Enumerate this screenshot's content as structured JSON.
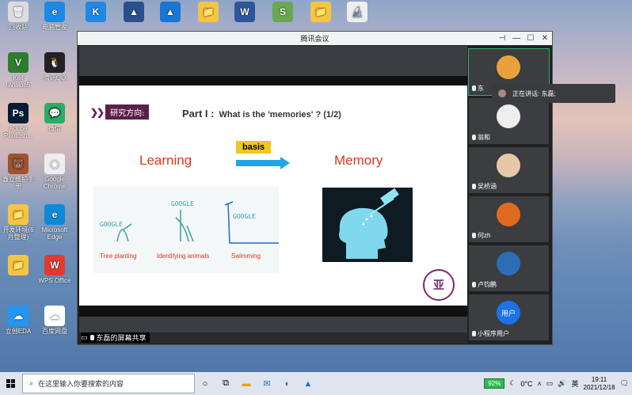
{
  "desktop": {
    "icons": [
      {
        "label": "回收站",
        "color": "#ddd",
        "glyph": "🗑"
      },
      {
        "label": "电脑管家",
        "color": "#1e88e5",
        "glyph": "e"
      },
      {
        "label": "",
        "color": "#1e88e5",
        "glyph": "K"
      },
      {
        "label": "",
        "color": "#2a4f8c",
        "glyph": "▲"
      },
      {
        "label": "",
        "color": "#1976d2",
        "glyph": "▲"
      },
      {
        "label": "",
        "color": "#f5c542",
        "glyph": "📁"
      },
      {
        "label": "",
        "color": "#2b579a",
        "glyph": "W"
      },
      {
        "label": "",
        "color": "#6aa84f",
        "glyph": "S"
      },
      {
        "label": "",
        "color": "#f5c542",
        "glyph": "📁"
      },
      {
        "label": "",
        "color": "#eee",
        "glyph": "🔬"
      },
      {
        "label": "Keil uVision5",
        "color": "#2d7d2d",
        "glyph": "V"
      },
      {
        "label": "腾讯QQ",
        "color": "#222",
        "glyph": "🐧"
      },
      {
        "label": "Adobe Photosh...",
        "color": "#001e36",
        "glyph": "Ps"
      },
      {
        "label": "微信",
        "color": "#2aae67",
        "glyph": "💬"
      },
      {
        "label": "鑫立维护手册",
        "color": "#a0522d",
        "glyph": "🐻"
      },
      {
        "label": "Google Chrome",
        "color": "#eee",
        "glyph": "◉"
      },
      {
        "label": "开发环境(6月整理)",
        "color": "#f5c542",
        "glyph": "📁"
      },
      {
        "label": "Microsoft Edge",
        "color": "#0c8ad6",
        "glyph": "e"
      },
      {
        "label": "",
        "color": "#f5c542",
        "glyph": "📁"
      },
      {
        "label": "WPS Office",
        "color": "#e23a2e",
        "glyph": "W"
      },
      {
        "label": "立创EDA",
        "color": "#2196f3",
        "glyph": "☁"
      },
      {
        "label": "百度网盘",
        "color": "#fff",
        "glyph": "☁"
      }
    ]
  },
  "window": {
    "title": "腾讯会议",
    "controls": {
      "pin": "⊣",
      "minimize": "—",
      "maximize": "☐",
      "close": "✕"
    }
  },
  "slide": {
    "tag": "研究方向:",
    "part": "Part I :",
    "question": "What is the 'memories' ? (1/2)",
    "learning": "Learning",
    "basis": "basis",
    "memory": "Memory",
    "captions": [
      "Tree planting",
      "Identifying animals",
      "Swimming"
    ],
    "doodles": [
      "GOOGLE",
      "GOOGLE",
      "GOOGLE"
    ]
  },
  "share_label": "东磊的屏幕共享",
  "participants": [
    {
      "name": "东",
      "avatar_color": "#e9a23b",
      "active": true
    },
    {
      "name": "翁和",
      "avatar_color": "#eee"
    },
    {
      "name": "吴桥涵",
      "avatar_color": "#e8c7a8"
    },
    {
      "name": "何zh",
      "avatar_color": "#e06a1f"
    },
    {
      "name": "卢钧鹏",
      "avatar_color": "#2d6db5"
    },
    {
      "name": "小程序用户",
      "avatar_color": "#1a73e8",
      "avatar_text": "用户"
    }
  ],
  "speaker_tip": "正在讲话: 东磊;",
  "taskbar": {
    "search_placeholder": "在这里输入你要搜索的内容",
    "battery": "92%",
    "weather": "0°C",
    "ime": "英",
    "time": "19:11",
    "date": "2021/12/18"
  }
}
